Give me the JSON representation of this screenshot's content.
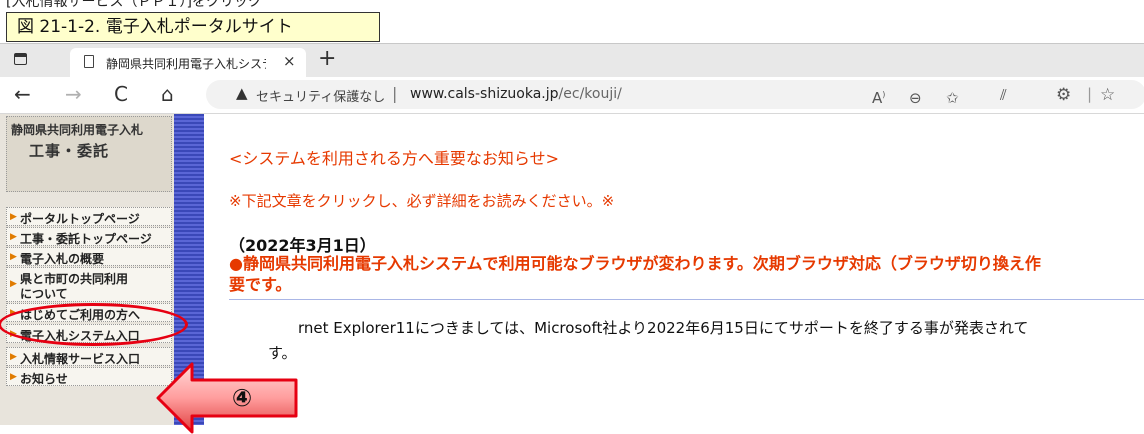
{
  "top_cut_text": "[入札情報サービス（ＰＰＩ）]をクリック",
  "figure_caption": "図 21-1-2. 電子入札ポータルサイト",
  "browser": {
    "tab_title": "静岡県共同利用電子入札システム",
    "tab_close": "×",
    "new_tab": "+",
    "nav": {
      "back": "←",
      "forward": "→",
      "reload": "C",
      "home": "⌂"
    },
    "security_label": "セキュリティ保護なし",
    "url_separator": "|",
    "url_host": "www.cals-shizuoka.jp",
    "url_path": "/ec/kouji/",
    "toolbar_icons": {
      "read_aloud": "A",
      "zoom": "⊖",
      "favorite_add": "✩",
      "split": "⫽",
      "extensions": "⚙",
      "favorites": "☆"
    }
  },
  "sidebar": {
    "header_line1": "静岡県共同利用電子入札",
    "header_line2": "工事・委託",
    "items": [
      {
        "label": "ポータルトップページ"
      },
      {
        "label": "工事・委託トップページ"
      },
      {
        "label": "電子入札の概要"
      },
      {
        "label": "県と市町の共同利用",
        "label2": "について"
      },
      {
        "label": "はじめてご利用の方へ"
      },
      {
        "label": "電子入札システム入口"
      },
      {
        "label": "入札情報サービス入口"
      },
      {
        "label": "お知らせ"
      }
    ]
  },
  "content": {
    "notice_title": "<システムを利用される方へ重要なお知らせ>",
    "notice_sub": "※下記文章をクリックし、必ず詳細をお読みください。※",
    "date": "（2022年3月1日）",
    "bold_line1": "●静岡県共同利用電子入札システムで利用可能なブラウザが変わります。次期ブラウザ対応（ブラウザ切り換え作",
    "bold_line2": "要です。",
    "ie_line": "rnet Explorer11につきましては、Microsoft社より2022年6月15日にてサポートを終了する事が発表されて",
    "ie_line2": "す。"
  },
  "callout": {
    "label": "④",
    "color": "#e60012"
  }
}
